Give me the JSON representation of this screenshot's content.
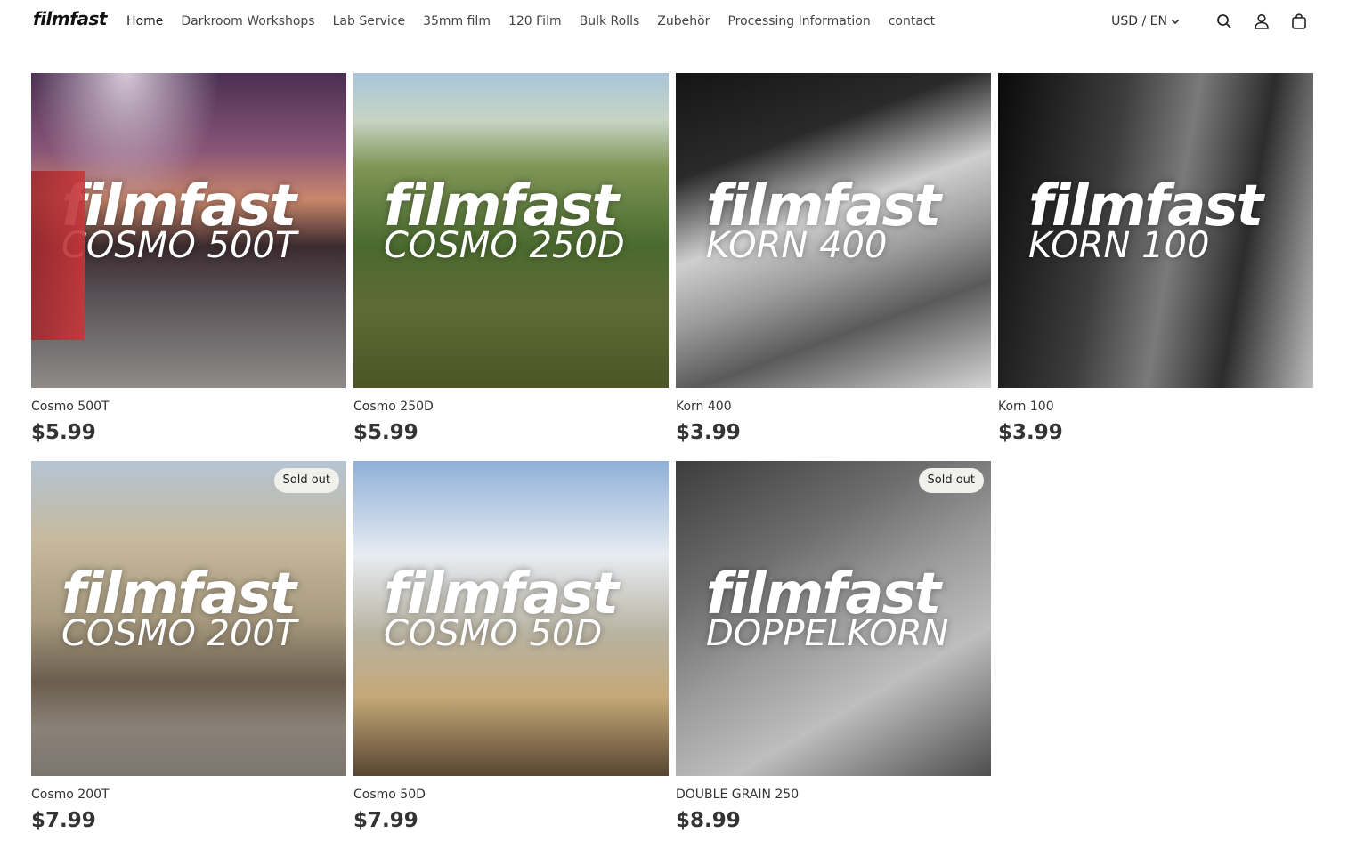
{
  "header": {
    "logo": "filmfast",
    "nav": [
      {
        "label": "Home"
      },
      {
        "label": "Darkroom Workshops"
      },
      {
        "label": "Lab Service"
      },
      {
        "label": "35mm film"
      },
      {
        "label": "120 Film"
      },
      {
        "label": "Bulk Rolls"
      },
      {
        "label": "Zubehör"
      },
      {
        "label": "Processing Information"
      },
      {
        "label": "contact"
      }
    ],
    "locale": "USD / EN",
    "icons": [
      "search-icon",
      "account-icon",
      "cart-icon"
    ]
  },
  "products": [
    {
      "image_brand": "filmfast",
      "image_film": "COSMO 500T",
      "title": "Cosmo 500T",
      "price": "$5.99",
      "badge": ""
    },
    {
      "image_brand": "filmfast",
      "image_film": "COSMO 250D",
      "title": "Cosmo 250D",
      "price": "$5.99",
      "badge": ""
    },
    {
      "image_brand": "filmfast",
      "image_film": "KORN 400",
      "title": "Korn 400",
      "price": "$3.99",
      "badge": ""
    },
    {
      "image_brand": "filmfast",
      "image_film": "KORN 100",
      "title": "Korn 100",
      "price": "$3.99",
      "badge": ""
    },
    {
      "image_brand": "filmfast",
      "image_film": "COSMO 200T",
      "title": "Cosmo 200T",
      "price": "$7.99",
      "badge": "Sold out"
    },
    {
      "image_brand": "filmfast",
      "image_film": "COSMO 50D",
      "title": "Cosmo 50D",
      "price": "$7.99",
      "badge": ""
    },
    {
      "image_brand": "filmfast",
      "image_film": "DOPPELKORN",
      "title": "DOUBLE GRAIN 250",
      "price": "$8.99",
      "badge": "Sold out"
    }
  ],
  "colors": {
    "text": "#333333",
    "badge_bg": "#f1f1ec",
    "background": "#ffffff"
  }
}
